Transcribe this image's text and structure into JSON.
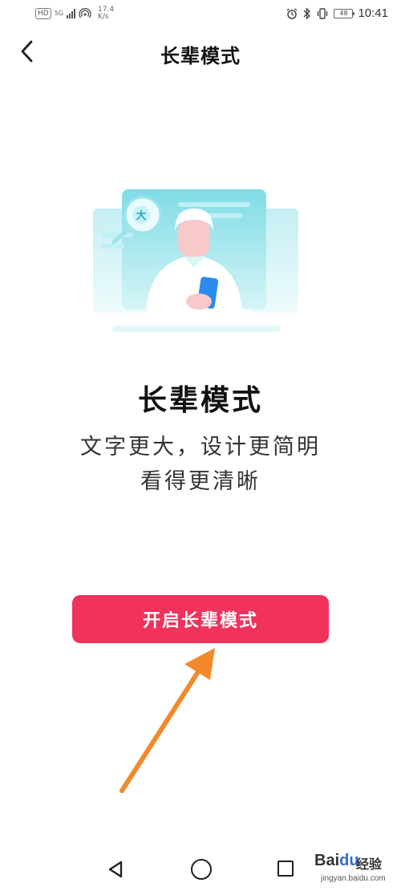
{
  "status_bar": {
    "hd": "HD",
    "network": "5G",
    "speed_value": "17.4",
    "speed_unit": "K/s",
    "battery": "48",
    "time": "10:41"
  },
  "header": {
    "title": "长辈模式"
  },
  "illustration": {
    "badge_char": "大"
  },
  "content": {
    "title": "长辈模式",
    "desc_line1": "文字更大，设计更简明",
    "desc_line2": "看得更清晰"
  },
  "actions": {
    "enable_label": "开启长辈模式"
  },
  "watermark": {
    "brand_prefix": "Bai",
    "brand_suffix": "du",
    "brand_cn": "经验",
    "url": "jingyan.baidu.com"
  },
  "colors": {
    "accent": "#f0325c",
    "arrow": "#f28a2c",
    "illustration": "#8fdfe6"
  }
}
